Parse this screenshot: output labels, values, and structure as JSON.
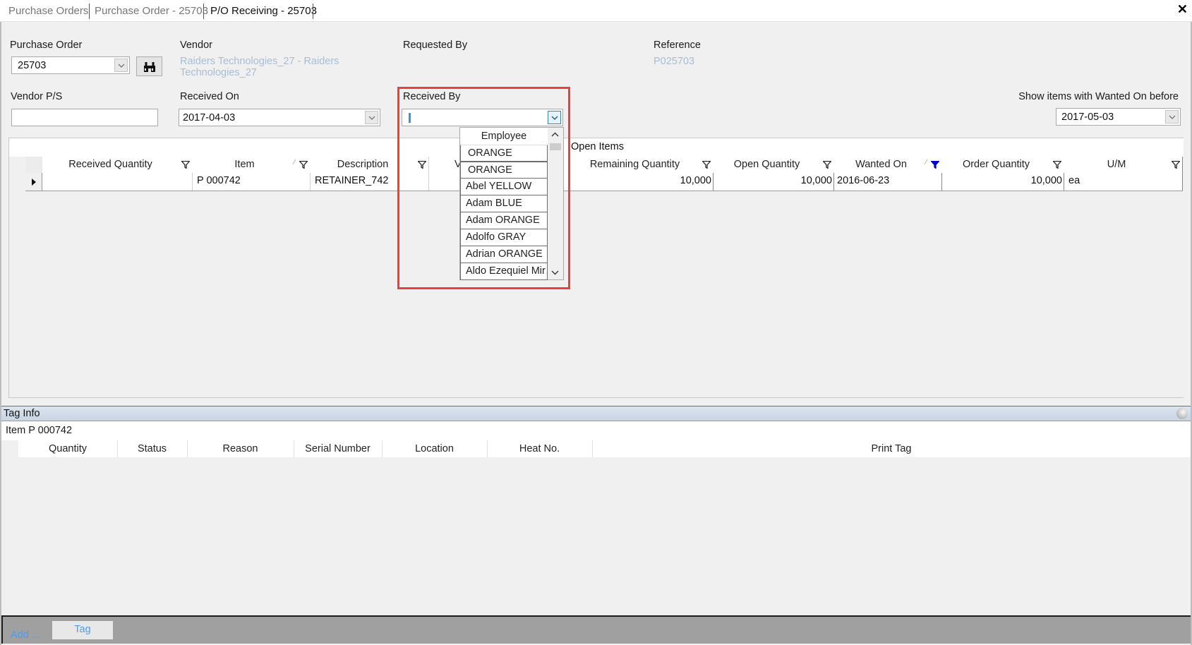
{
  "tabs": [
    {
      "label": "Purchase Orders",
      "active": false
    },
    {
      "label": "Purchase Order - 25703",
      "active": false
    },
    {
      "label": "P/O Receiving - 25703",
      "active": true
    }
  ],
  "close_icon": "close-x-icon",
  "header": {
    "purchase_order": {
      "label": "Purchase Order",
      "value": "25703"
    },
    "vendor": {
      "label": "Vendor",
      "line1": "Raiders Technologies_27 - Raiders",
      "line2": "Technologies_27"
    },
    "requested_by": {
      "label": "Requested By",
      "value": ""
    },
    "reference": {
      "label": "Reference",
      "value": "P025703"
    },
    "vendor_ps": {
      "label": "Vendor P/S",
      "value": ""
    },
    "received_on": {
      "label": "Received On",
      "value": "2017-04-03"
    },
    "received_by": {
      "label": "Received By",
      "value": ""
    },
    "show_items": {
      "label": "Show items with Wanted On before",
      "value": "2017-05-03"
    }
  },
  "received_by_dropdown": {
    "header": "Employee",
    "items": [
      "ORANGE",
      "ORANGE",
      "Abel YELLOW",
      "Adam BLUE",
      "Adam ORANGE",
      "Adolfo GRAY",
      "Adrian ORANGE",
      "Aldo Ezequiel Mir"
    ]
  },
  "grid": {
    "group_label": "Open Items",
    "columns": [
      {
        "label": "Received Quantity"
      },
      {
        "label": "Item"
      },
      {
        "label": "Description"
      },
      {
        "label": "V"
      },
      {
        "label": "Remaining Quantity"
      },
      {
        "label": "Open Quantity"
      },
      {
        "label": "Wanted On"
      },
      {
        "label": "Order Quantity"
      },
      {
        "label": "U/M"
      }
    ],
    "rows": [
      {
        "received_quantity": "",
        "item": "P 000742",
        "description": "RETAINER_742",
        "remaining_quantity": "10,000",
        "open_quantity": "10,000",
        "wanted_on": "2016-06-23",
        "order_quantity": "10,000",
        "um": "ea"
      }
    ]
  },
  "tag_info": {
    "title": "Tag Info",
    "item_label": "Item P 000742",
    "columns": [
      "Quantity",
      "Status",
      "Reason",
      "Serial Number",
      "Location",
      "Heat No.",
      "Print Tag"
    ]
  },
  "bottom": {
    "add_label": "Add ...",
    "tag_label": "Tag"
  },
  "colors": {
    "highlight": "#e8413f",
    "link": "#a9bcd6",
    "active_filter": "#0000cc"
  }
}
